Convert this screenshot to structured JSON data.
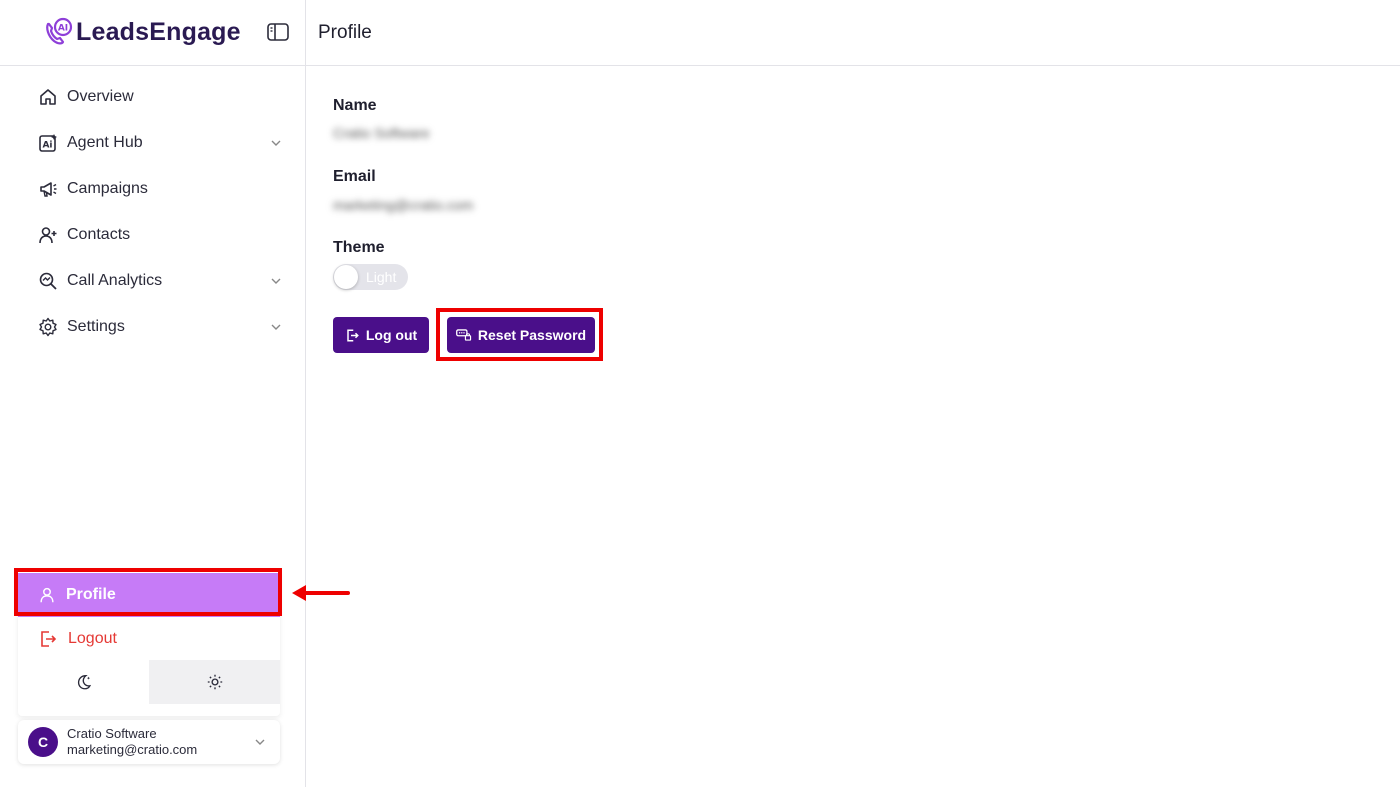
{
  "brand": {
    "name": "LeadsEngage"
  },
  "header": {
    "title": "Profile"
  },
  "sidebar": {
    "items": [
      {
        "label": "Overview",
        "icon": "home-icon",
        "expandable": false
      },
      {
        "label": "Agent Hub",
        "icon": "ai-icon",
        "expandable": true
      },
      {
        "label": "Campaigns",
        "icon": "megaphone-icon",
        "expandable": false
      },
      {
        "label": "Contacts",
        "icon": "user-plus-icon",
        "expandable": false
      },
      {
        "label": "Call Analytics",
        "icon": "analytics-icon",
        "expandable": true
      },
      {
        "label": "Settings",
        "icon": "gear-icon",
        "expandable": true
      }
    ]
  },
  "user_menu": {
    "profile_label": "Profile",
    "logout_label": "Logout",
    "modes": [
      "dark",
      "light"
    ],
    "active_mode": "light"
  },
  "user": {
    "initial": "C",
    "name": "Cratio Software",
    "email": "marketing@cratio.com"
  },
  "profile": {
    "name_label": "Name",
    "name_value": "Cratio Software",
    "email_label": "Email",
    "email_value": "marketing@cratio.com",
    "theme_label": "Theme",
    "theme_value": "Light",
    "logout_button": "Log out",
    "reset_button": "Reset Password"
  },
  "colors": {
    "primary": "#4a0f8a",
    "active_menu": "#c67bf7",
    "logout": "#e53935",
    "annotation": "#ee0000"
  }
}
